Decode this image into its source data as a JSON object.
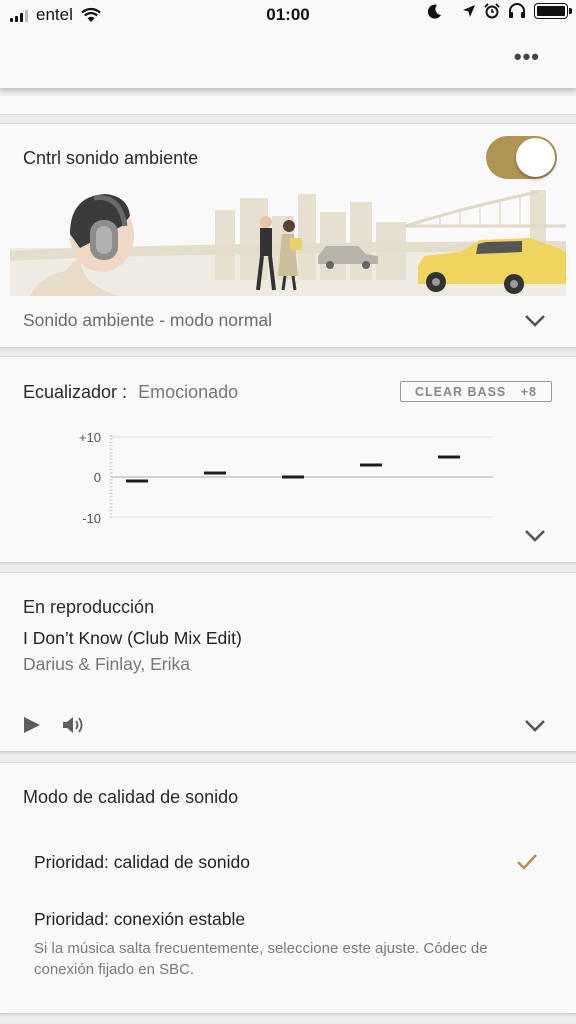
{
  "status_bar": {
    "carrier": "entel",
    "time": "01:00",
    "icons": [
      "signal-icon",
      "wifi-icon",
      "moon-icon",
      "location-icon",
      "alarm-icon",
      "headphones-icon",
      "battery-icon"
    ]
  },
  "header": {
    "more_label": "•••"
  },
  "ambient": {
    "title": "Cntrl sonido ambiente",
    "toggle_on": true,
    "mode_label": "Sonido ambiente - modo normal"
  },
  "equalizer": {
    "title": "Ecualizador :",
    "preset": "Emocionado",
    "clear_bass_label": "CLEAR BASS",
    "clear_bass_value": "+8",
    "y_ticks": [
      "+10",
      "0",
      "-10"
    ],
    "bands": [
      -1,
      1,
      0,
      3,
      5
    ]
  },
  "now_playing": {
    "title": "En reproducción",
    "track": "I Don’t Know (Club Mix Edit)",
    "artist": "Darius & Finlay, Erika"
  },
  "quality": {
    "title": "Modo de calidad de sonido",
    "option1": "Prioridad: calidad de sonido",
    "option2": "Prioridad: conexión estable",
    "option2_desc": "Si la música salta frecuentemente, seleccione este ajuste. Códec de conexión fijado en SBC.",
    "selected": 1
  },
  "colors": {
    "accent": "#ae9556",
    "card": "#f9f9f9",
    "background": "#ececec"
  }
}
